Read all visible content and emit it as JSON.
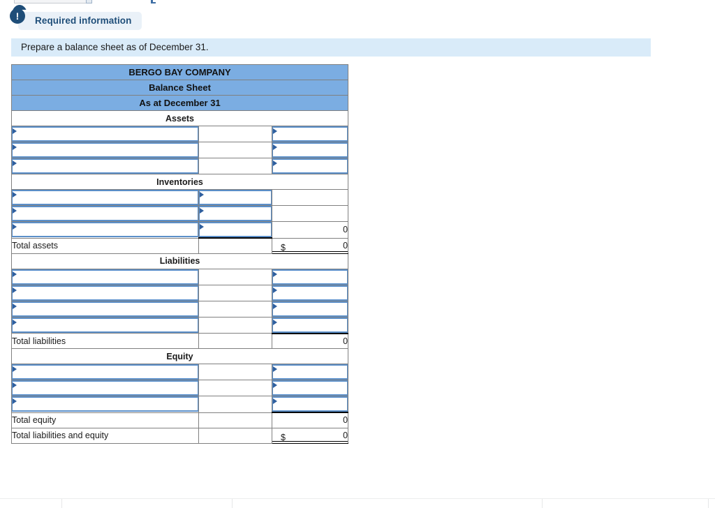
{
  "top_widgets": {
    "cut_input_icon": "text-input-cutoff",
    "cut_glyph_icon": "bracket-glyph-cutoff",
    "cut_arc_icon": "badge-arc-cutoff"
  },
  "required_info": {
    "badge_glyph": "!",
    "label": "Required information"
  },
  "instruction": {
    "text": "Prepare a balance sheet as of December 31."
  },
  "balance_sheet": {
    "header_lines": [
      "BERGO BAY COMPANY",
      "Balance Sheet",
      "As at December 31"
    ],
    "sections": {
      "assets": "Assets",
      "inventories": "Inventories",
      "liabilities": "Liabilities",
      "equity": "Equity"
    },
    "totals": {
      "total_assets_label": "Total assets",
      "total_assets_dollar": "$",
      "total_assets_value": "0",
      "inventories_subtotal_value": "0",
      "total_liabilities_label": "Total liabilities",
      "total_liabilities_value": "0",
      "total_equity_label": "Total equity",
      "total_equity_value": "0",
      "total_liab_equity_label": "Total liabilities and equity",
      "total_liab_equity_dollar": "$",
      "total_liab_equity_value": "0"
    },
    "input_placeholder": "",
    "dropdown_marker_icon": "dropdown-triangle-icon"
  },
  "colors": {
    "header_blue": "#7bade2",
    "banner_blue": "#d9ebf9",
    "badge_navy": "#1f4e79",
    "input_border": "#5b8fc9",
    "grid_gray": "#808080"
  }
}
